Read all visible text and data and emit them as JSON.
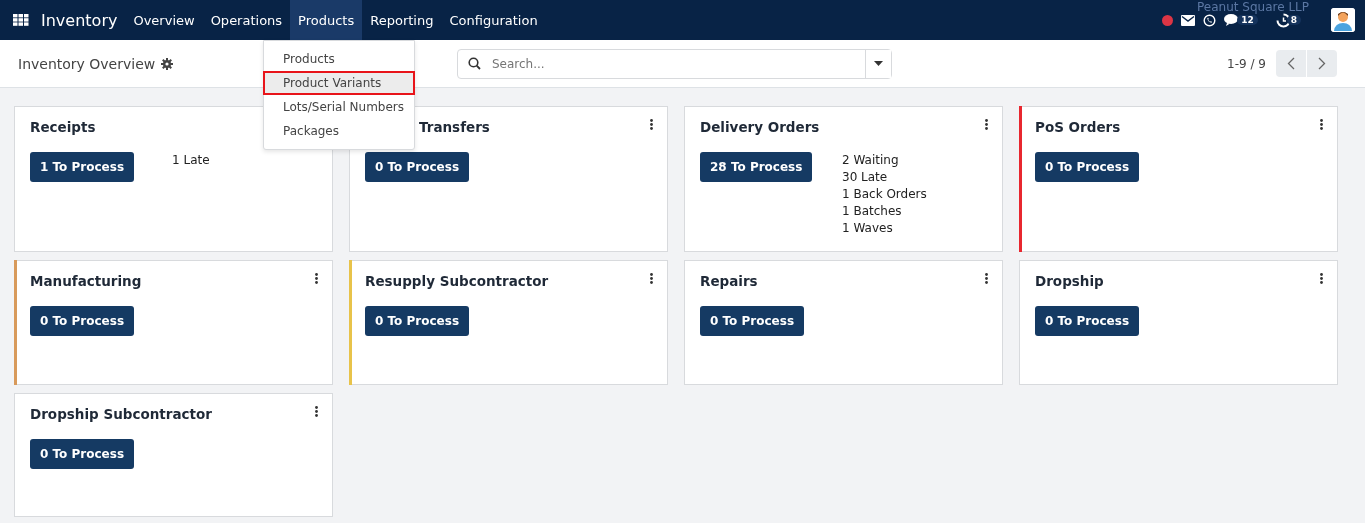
{
  "navbar": {
    "app": "Inventory",
    "menus": [
      {
        "label": "Overview",
        "selected": false
      },
      {
        "label": "Operations",
        "selected": false
      },
      {
        "label": "Products",
        "selected": true
      },
      {
        "label": "Reporting",
        "selected": false
      },
      {
        "label": "Configuration",
        "selected": false
      }
    ],
    "messages_count": "12",
    "activity_count": "8",
    "company": "Peanut Square LLP"
  },
  "dropdown": [
    {
      "label": "Products",
      "selected": false
    },
    {
      "label": "Product Variants",
      "selected": true
    },
    {
      "label": "Lots/Serial Numbers",
      "selected": false
    },
    {
      "label": "Packages",
      "selected": false
    }
  ],
  "control_panel": {
    "title": "Inventory Overview",
    "search": {
      "placeholder": "Search..."
    },
    "pager": "1-9 / 9"
  },
  "cards": [
    {
      "title": "Receipts",
      "covered": false,
      "button": "1 To Process",
      "stats": [
        "1 Late"
      ]
    },
    {
      "title": "Transfers",
      "covered": true,
      "button": "0 To Process"
    },
    {
      "title": "Delivery Orders",
      "covered": false,
      "button": "28 To Process",
      "stats": [
        "2 Waiting",
        "30 Late",
        "1 Back Orders",
        "1 Batches",
        "1 Waves"
      ]
    },
    {
      "title": "PoS Orders",
      "covered": false,
      "button": "0 To Process",
      "color": "#e8272f"
    },
    {
      "title": "Manufacturing",
      "covered": false,
      "button": "0 To Process",
      "color": "#d89a5b"
    },
    {
      "title": "Resupply Subcontractor",
      "covered": false,
      "button": "0 To Process",
      "color": "#e8c34a"
    },
    {
      "title": "Repairs",
      "covered": false,
      "button": "0 To Process"
    },
    {
      "title": "Dropship",
      "covered": false,
      "button": "0 To Process"
    },
    {
      "title": "Dropship Subcontractor",
      "covered": false,
      "button": "0 To Process"
    }
  ]
}
